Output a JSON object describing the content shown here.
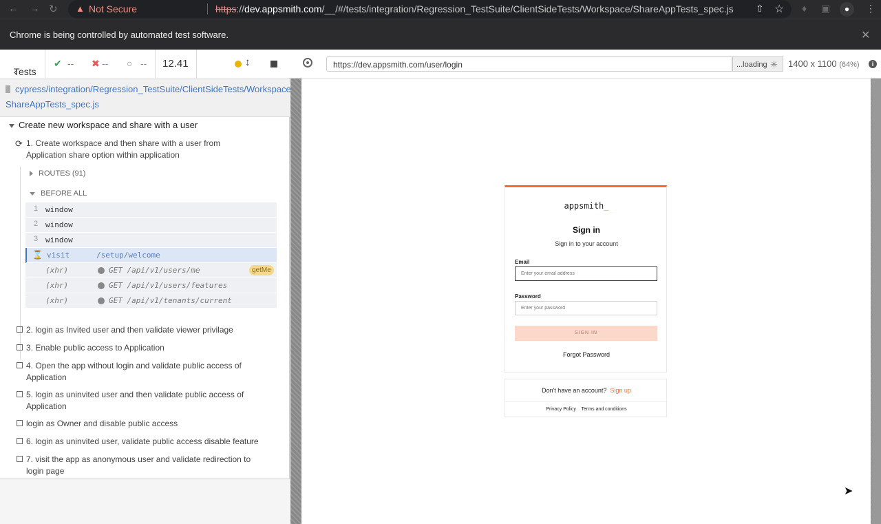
{
  "browser": {
    "not_secure": "Not Secure",
    "url_scheme": "https",
    "url_host": "dev.appsmith.com",
    "url_path": "/__/#/tests/integration/Regression_TestSuite/ClientSideTests/Workspace/ShareAppTests_spec.js",
    "infobar": "Chrome is being controlled by automated test software."
  },
  "reporter": {
    "tests_label": "Tests",
    "passed": "--",
    "failed": "--",
    "pending": "--",
    "duration": "12.41",
    "spec_path_1": "cypress/integration/Regression_TestSuite/ClientSideTests/Workspace/",
    "spec_path_2": "ShareAppTests_spec.js",
    "suite_title": "Create new workspace and share with a user",
    "running_test": "1. Create workspace and then share with a user from Application share option within application",
    "routes_label": "ROUTES (91)",
    "before_all_label": "BEFORE ALL",
    "commands": [
      {
        "num": "1",
        "name": "window",
        "arg": ""
      },
      {
        "num": "2",
        "name": "window",
        "arg": ""
      },
      {
        "num": "3",
        "name": "window",
        "arg": ""
      },
      {
        "num": "",
        "name": "visit",
        "arg": "/setup/welcome"
      },
      {
        "num": "",
        "name": "(xhr)",
        "arg": "GET /api/v1/users/me",
        "alias": "getMe"
      },
      {
        "num": "",
        "name": "(xhr)",
        "arg": "GET /api/v1/users/features"
      },
      {
        "num": "",
        "name": "(xhr)",
        "arg": "GET /api/v1/tenants/current"
      }
    ],
    "tests": [
      "2. login as Invited user and then validate viewer privilage",
      "3. Enable public access to Application",
      "4. Open the app without login and validate public access of Application",
      "5. login as uninvited user and then validate public access of Application",
      "login as Owner and disable public access",
      "6. login as uninvited user, validate public access disable feature",
      "7. visit the app as anonymous user and validate redirection to login page"
    ]
  },
  "aut": {
    "url": "https://dev.appsmith.com/user/login",
    "loading": "...loading",
    "viewport": "1400 x 1100",
    "scale": "(64%)"
  },
  "login": {
    "logo": "appsmith",
    "logo_underscore": "_",
    "title": "Sign in",
    "subtitle": "Sign in to your account",
    "email_label": "Email",
    "email_placeholder": "Enter your email address",
    "password_label": "Password",
    "password_placeholder": "Enter your password",
    "signin_button": "SIGN IN",
    "forgot": "Forgot Password",
    "no_account": "Don't have an account?",
    "signup": "Sign up",
    "privacy": "Privacy Policy",
    "terms": "Terms and conditions"
  }
}
